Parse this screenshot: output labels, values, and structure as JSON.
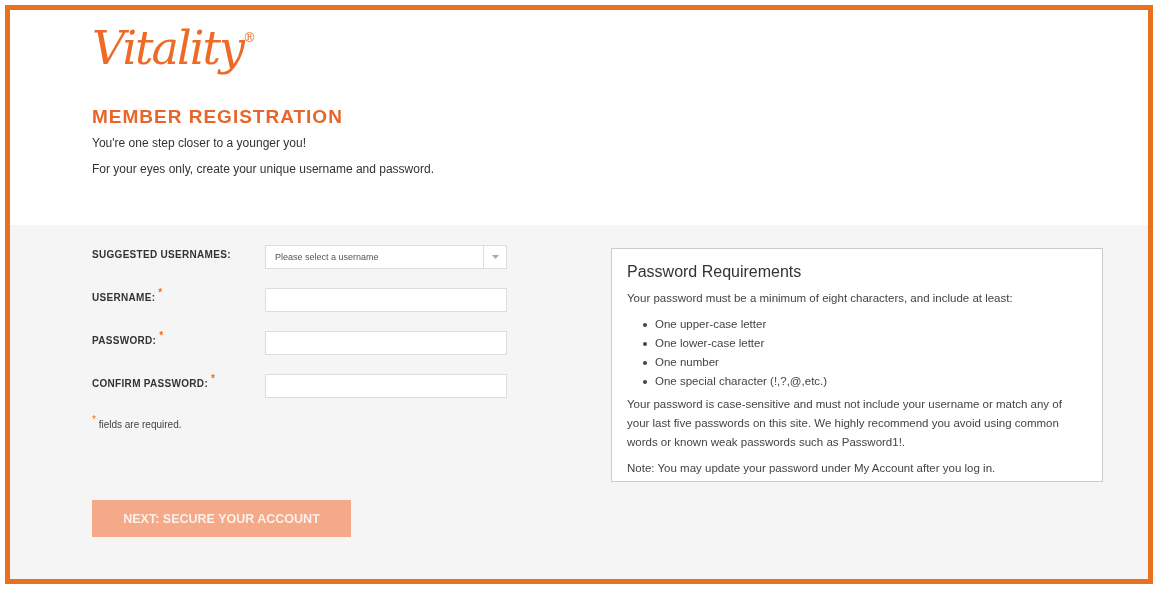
{
  "logo": {
    "text": "Vitality",
    "mark": "®"
  },
  "heading": "MEMBER REGISTRATION",
  "intro": [
    "You're one step closer to a younger you!",
    "For your eyes only, create your unique username and password."
  ],
  "form": {
    "fields": [
      {
        "kind": "select",
        "label": "SUGGESTED USERNAMES:",
        "required": false,
        "placeholder": "Please select a username"
      },
      {
        "kind": "text",
        "label": "USERNAME:",
        "required": true
      },
      {
        "kind": "text",
        "label": "PASSWORD:",
        "required": true
      },
      {
        "kind": "text",
        "label": "CONFIRM PASSWORD:",
        "required": true
      }
    ],
    "required_note": {
      "mark": "*",
      "text": "fields are required."
    }
  },
  "requirements": {
    "title": "Password Requirements",
    "intro": "Your password must be a minimum of eight characters, and include at least:",
    "items": [
      "One upper-case letter",
      "One lower-case letter",
      "One number",
      "One special character (!,?,@,etc.)"
    ],
    "paragraphs": [
      "Your password is case-sensitive and must not include your username or match any of your last five passwords on this site. We highly recommend you avoid using common words or known weak passwords such as Password1!.",
      "Note: You may update your password under My Account after you log in."
    ]
  },
  "next_button": {
    "label": "NEXT: SECURE YOUR ACCOUNT",
    "disabled": true
  }
}
